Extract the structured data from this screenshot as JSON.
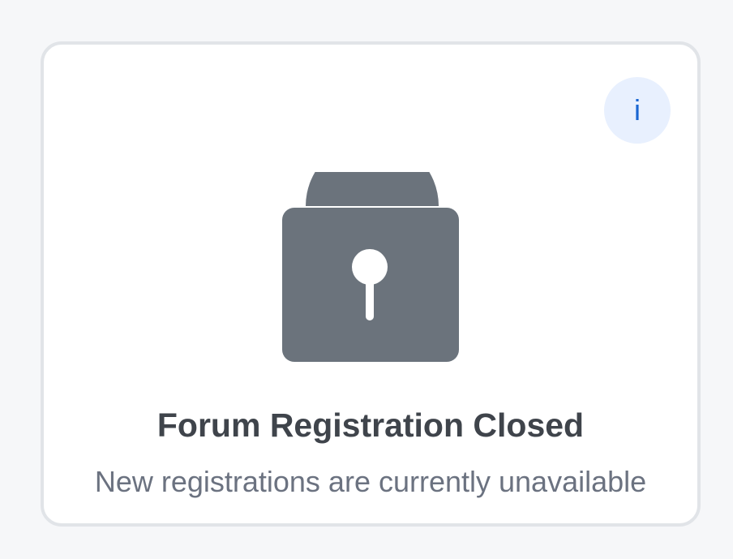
{
  "card": {
    "title": "Forum Registration Closed",
    "subtitle": "New registrations are currently unavailable"
  },
  "info_button": {
    "label": "i",
    "icon": "info-icon"
  },
  "lock": {
    "icon": "lock-icon"
  },
  "colors": {
    "page_background": "#f6f7f9",
    "card_border": "#e1e4e8",
    "lock": "#6b737c",
    "info_background": "#e8f0fe",
    "info_text": "#1a66d2",
    "title": "#3f444b",
    "subtitle": "#6b7280"
  }
}
